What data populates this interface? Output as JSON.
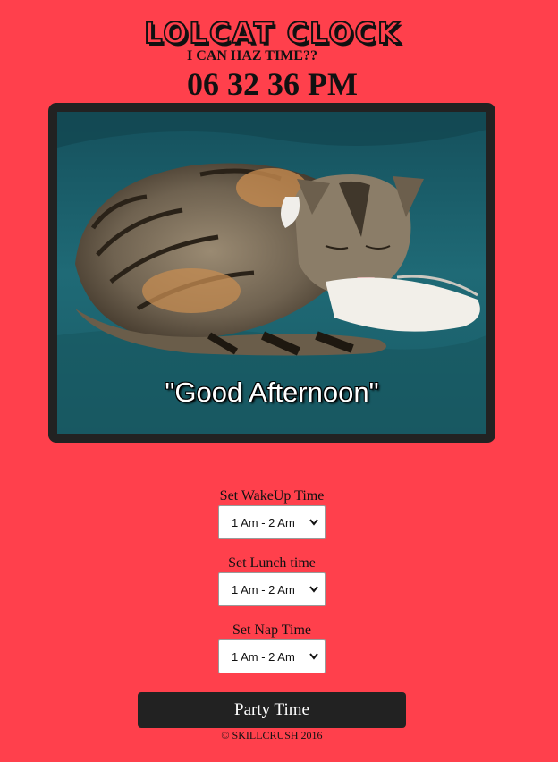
{
  "header": {
    "title": "LOLCAT CLOCK",
    "subtitle": "I CAN HAZ TIME??",
    "clock": "06 32 36 PM"
  },
  "photo": {
    "subject": "sleeping-cat",
    "caption": "\"Good Afternoon\""
  },
  "form": {
    "wakeup_label": "Set WakeUp Time",
    "wakeup_value": "1 Am - 2 Am",
    "lunch_label": "Set Lunch time",
    "lunch_value": "1 Am - 2 Am",
    "nap_label": "Set Nap Time",
    "nap_value": "1 Am - 2 Am",
    "party_button": "Party Time"
  },
  "footer": {
    "text": "© SKILLCRUSH 2016"
  },
  "colors": {
    "background": "#ff404c",
    "frame": "#222222",
    "button": "#222222"
  }
}
